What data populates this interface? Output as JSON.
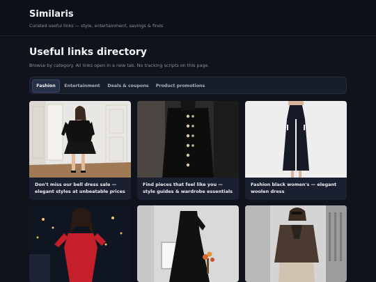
{
  "header": {
    "brand": "Similaris",
    "tagline": "Curated useful links — style, entertainment, savings & finds"
  },
  "main": {
    "title": "Useful links directory",
    "subtitle": "Browse by category. All links open in a new tab. No tracking scripts on this page."
  },
  "tabs": [
    {
      "label": "Fashion",
      "active": true
    },
    {
      "label": "Entertainment",
      "active": false
    },
    {
      "label": "Deals & coupons",
      "active": false
    },
    {
      "label": "Product promotions",
      "active": false
    }
  ],
  "cards": [
    {
      "caption": "Don't miss our bell dress sale — elegant styles at unbeatable prices"
    },
    {
      "caption": "Find pieces that feel like you — style guides & wardrobe essentials"
    },
    {
      "caption": "Fashion black women's — elegant woolen dress"
    },
    {
      "caption": ""
    },
    {
      "caption": ""
    },
    {
      "caption": ""
    }
  ],
  "colors": {
    "background": "#10131c",
    "card": "#1a2030",
    "active_tab": "#263147"
  }
}
